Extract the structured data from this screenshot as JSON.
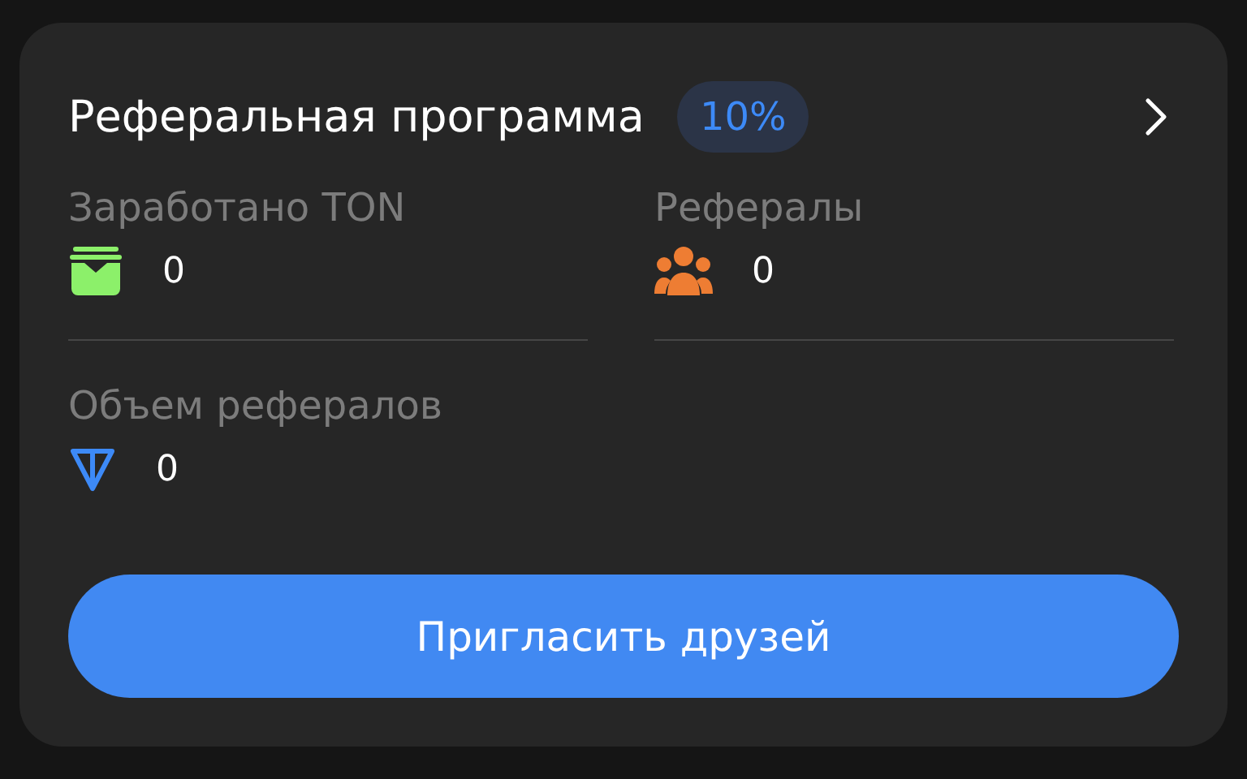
{
  "card": {
    "title": "Реферальная программа",
    "badge": "10%"
  },
  "stats": [
    {
      "kind": "wallet",
      "label": "Заработано TON",
      "value": "0"
    },
    {
      "kind": "people",
      "label": "Рефералы",
      "value": "0"
    },
    {
      "kind": "ton",
      "label": "Объем рефералов",
      "value": "0"
    }
  ],
  "button": "Пригласить друзей"
}
